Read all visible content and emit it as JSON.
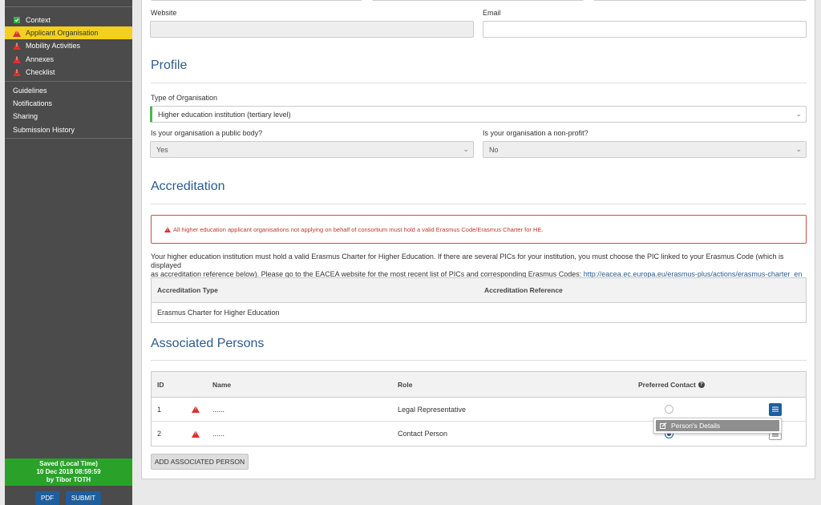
{
  "sidebar": {
    "items": [
      {
        "label": "Context",
        "status": "ok"
      },
      {
        "label": "Applicant Organisation",
        "status": "warning",
        "active": true
      },
      {
        "label": "Mobility Activities",
        "status": "warning"
      },
      {
        "label": "Annexes",
        "status": "warning"
      },
      {
        "label": "Checklist",
        "status": "warning"
      }
    ],
    "links": [
      "Guidelines",
      "Notifications",
      "Sharing",
      "Submission History"
    ],
    "saved": {
      "line1": "Saved (Local Time)",
      "line2": "10 Dec 2018 08:59:59",
      "line3": "by Tibor TOTH"
    },
    "pdf_label": "PDF",
    "submit_label": "SUBMIT"
  },
  "contact": {
    "website_label": "Website",
    "website_value": "",
    "email_label": "Email",
    "email_value": ""
  },
  "profile": {
    "title": "Profile",
    "org_type_label": "Type of Organisation",
    "org_type_value": "Higher education institution (tertiary level)",
    "public_body_label": "Is your organisation a public body?",
    "public_body_value": "Yes",
    "non_profit_label": "Is your organisation a non-profit?",
    "non_profit_value": "No"
  },
  "accreditation": {
    "title": "Accreditation",
    "alert": "All higher education applicant organisations not applying on behalf of consortium must hold a valid Erasmus Code/Erasmus Charter for HE.",
    "paragraph_line1": "Your higher education institution must hold a valid Erasmus Charter for Higher Education. If there are several PICs for your institution, you must choose the PIC linked to your Erasmus Code (which is displayed",
    "paragraph_line2_prefix": "as accreditation reference below). Please go to the EACEA website for the most recent list of PICs and corresponding Erasmus Codes: ",
    "paragraph_link": "http://eacea.ec.europa.eu/erasmus-plus/actions/erasmus-charter_en",
    "columns": [
      "Accreditation Type",
      "Accreditation Reference"
    ],
    "rows": [
      [
        "Erasmus Charter for Higher Education",
        ""
      ]
    ]
  },
  "associated_persons": {
    "title": "Associated Persons",
    "columns": [
      "ID",
      "Name",
      "Role",
      "Preferred Contact"
    ],
    "rows": [
      {
        "id": "1",
        "name": "......",
        "role": "Legal Representative",
        "preferred": false
      },
      {
        "id": "2",
        "name": "......",
        "role": "Contact Person",
        "preferred": true
      }
    ],
    "dropdown_item": "Person's Details",
    "add_button": "ADD ASSOCIATED PERSON"
  },
  "colors": {
    "accent": "#2b5b8e",
    "active_nav": "#f4d01e",
    "saved_bg": "#2aa22a",
    "warning": "#d9322e"
  }
}
